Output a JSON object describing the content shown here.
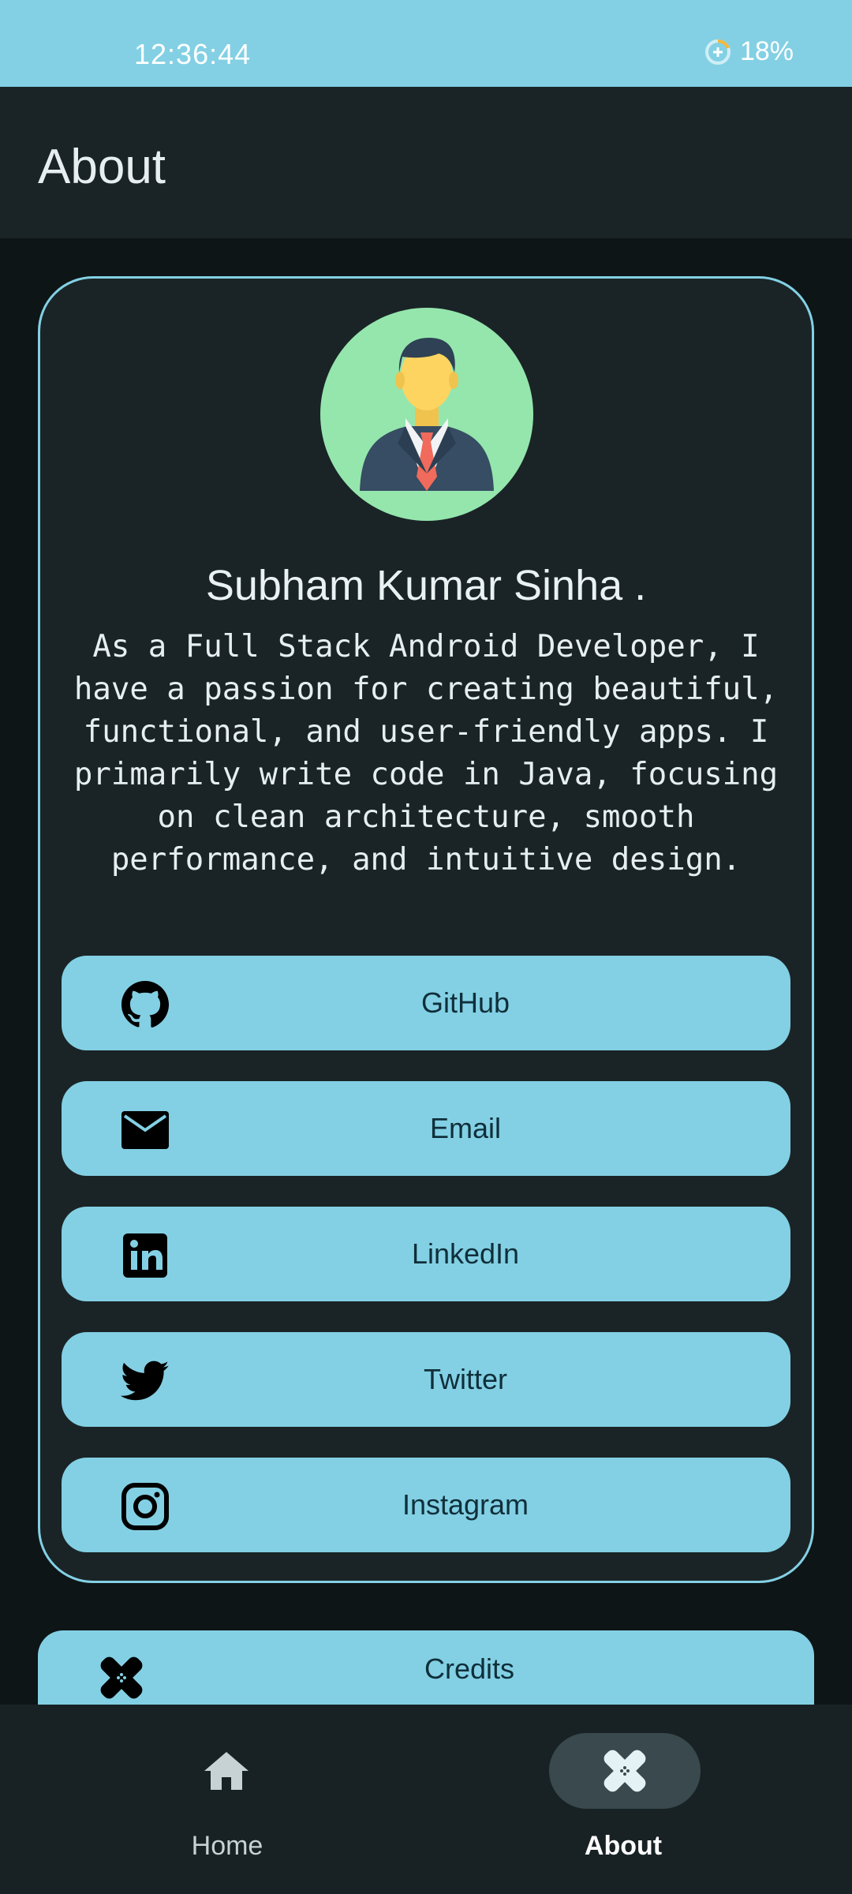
{
  "status_bar": {
    "time": "12:36:44",
    "battery": "18%"
  },
  "app_bar": {
    "title": "About"
  },
  "profile": {
    "avatar_icon": "businessman-avatar-icon",
    "name": "Subham Kumar Sinha .",
    "bio": "As a Full Stack Android Developer, I have a passion for creating beautiful, functional, and user-friendly apps. I primarily write code in Java, focusing on clean architecture, smooth performance, and intuitive design."
  },
  "links": [
    {
      "label": "GitHub",
      "icon": "github-icon"
    },
    {
      "label": "Email",
      "icon": "email-icon"
    },
    {
      "label": "LinkedIn",
      "icon": "linkedin-icon"
    },
    {
      "label": "Twitter",
      "icon": "twitter-icon"
    },
    {
      "label": "Instagram",
      "icon": "instagram-icon"
    }
  ],
  "credits": {
    "label": "Credits",
    "icon": "bandage-icon"
  },
  "bottom_nav": {
    "items": [
      {
        "label": "Home",
        "icon": "home-icon",
        "selected": false
      },
      {
        "label": "About",
        "icon": "bandage-icon",
        "selected": true
      }
    ]
  },
  "colors": {
    "accent": "#83d0e4",
    "background": "#0e1517",
    "surface": "#1a2427",
    "button_text": "#0f2f3a"
  }
}
